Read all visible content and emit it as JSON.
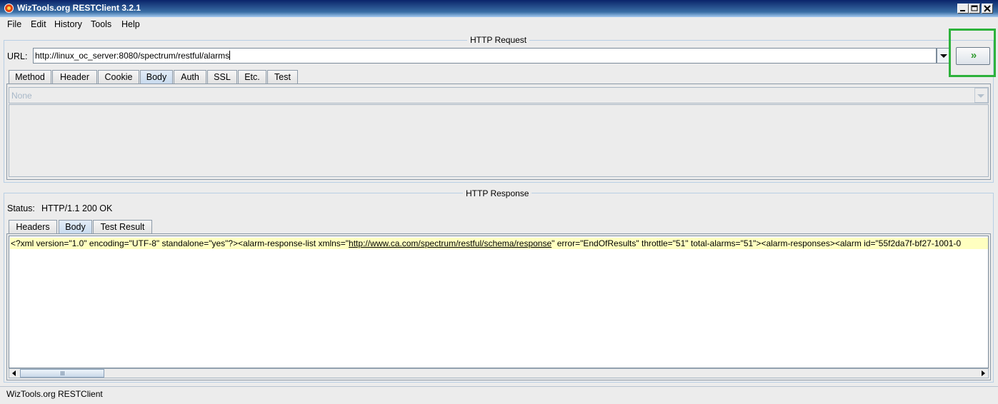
{
  "window": {
    "title": "WizTools.org RESTClient 3.2.1",
    "accent": "#0a246a"
  },
  "menu": {
    "items": [
      "File",
      "Edit",
      "History",
      "Tools",
      "Help"
    ]
  },
  "request": {
    "group_title": "HTTP Request",
    "url_label": "URL:",
    "url_value": "http://linux_oc_server:8080/spectrum/restful/alarms",
    "go_label": "»",
    "tabs": [
      "Method",
      "Header",
      "Cookie",
      "Body",
      "Auth",
      "SSL",
      "Etc.",
      "Test"
    ],
    "active_tab": "Body",
    "body_content_type": "None"
  },
  "response": {
    "group_title": "HTTP Response",
    "status_label": "Status:",
    "status_value": "HTTP/1.1 200 OK",
    "tabs": [
      "Headers",
      "Body",
      "Test Result"
    ],
    "active_tab": "Body",
    "body_before_link": "<?xml version=\"1.0\" encoding=\"UTF-8\" standalone=\"yes\"?><alarm-response-list xmlns=\"",
    "body_link": "http://www.ca.com/spectrum/restful/schema/response",
    "body_after_link": "\" error=\"EndOfResults\" throttle=\"51\" total-alarms=\"51\"><alarm-responses><alarm id=\"55f2da7f-bf27-1001-0"
  },
  "statusbar": {
    "text": "WizTools.org RESTClient"
  },
  "colors": {
    "go_arrow": "#2e9a2e",
    "highlight": "#2db23b",
    "xml_bg": "#ffffc0"
  }
}
